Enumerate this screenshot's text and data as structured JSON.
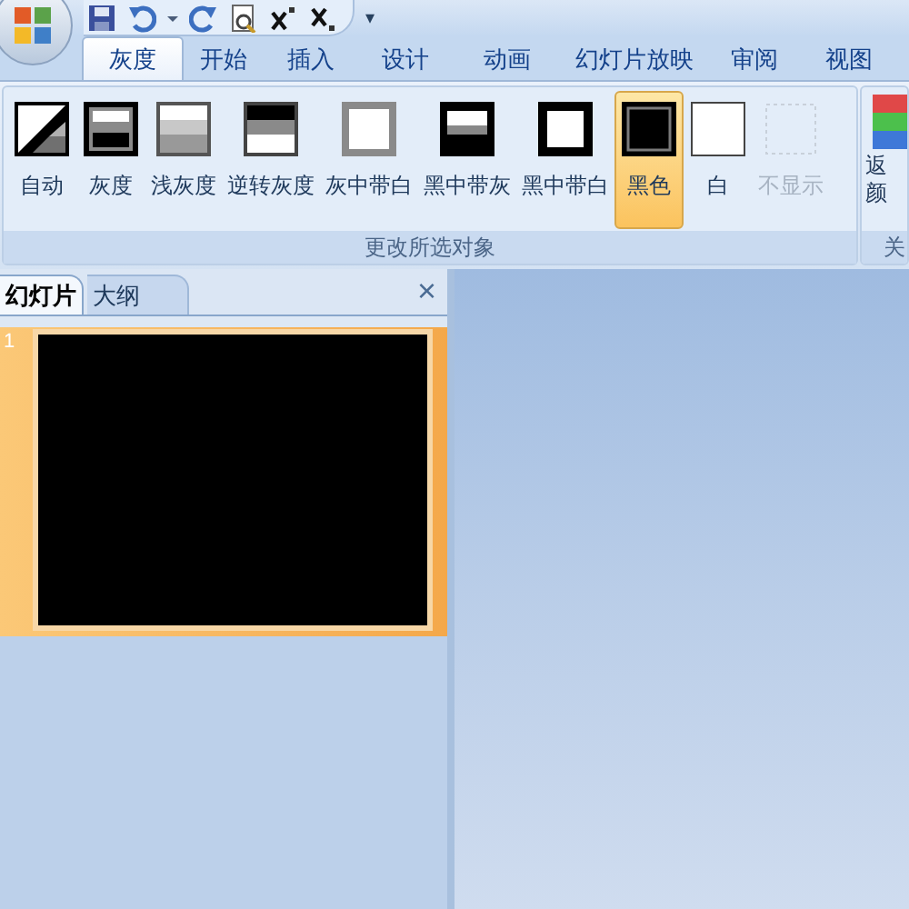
{
  "quick_access": {
    "customize": "▾"
  },
  "tabs": [
    {
      "label": "灰度",
      "selected": true
    },
    {
      "label": "开始",
      "selected": false
    },
    {
      "label": "插入",
      "selected": false
    },
    {
      "label": "设计",
      "selected": false
    },
    {
      "label": "动画",
      "selected": false
    },
    {
      "label": "幻灯片放映",
      "selected": false
    },
    {
      "label": "审阅",
      "selected": false
    },
    {
      "label": "视图",
      "selected": false
    }
  ],
  "ribbon_group": {
    "label": "更改所选对象",
    "buttons": [
      {
        "label": "自动",
        "kind": "auto",
        "selected": false,
        "disabled": false
      },
      {
        "label": "灰度",
        "kind": "gray",
        "selected": false,
        "disabled": false
      },
      {
        "label": "浅灰度",
        "kind": "light",
        "selected": false,
        "disabled": false
      },
      {
        "label": "逆转灰度",
        "kind": "inverse",
        "selected": false,
        "disabled": false
      },
      {
        "label": "灰中带白",
        "kind": "graywhite",
        "selected": false,
        "disabled": false
      },
      {
        "label": "黑中带灰",
        "kind": "blackgray",
        "selected": false,
        "disabled": false
      },
      {
        "label": "黑中带白",
        "kind": "blackwhite",
        "selected": false,
        "disabled": false
      },
      {
        "label": "黑色",
        "kind": "black",
        "selected": true,
        "disabled": false
      },
      {
        "label": "白",
        "kind": "white",
        "selected": false,
        "disabled": false
      },
      {
        "label": "不显示",
        "kind": "none",
        "selected": false,
        "disabled": true
      }
    ]
  },
  "next_group": {
    "button_lines": [
      "返",
      "颜"
    ],
    "label": "关"
  },
  "panel": {
    "tabs": [
      {
        "label": "幻灯片",
        "selected": true
      },
      {
        "label": "大纲",
        "selected": false
      }
    ],
    "close": "×",
    "slides": [
      {
        "number": "1",
        "selected": true
      }
    ]
  }
}
